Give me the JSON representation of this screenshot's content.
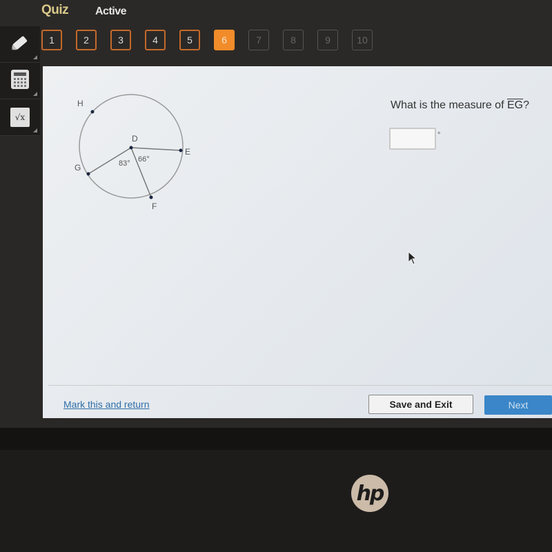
{
  "header": {
    "title": "Quiz",
    "status": "Active"
  },
  "question_nav": [
    {
      "label": "1",
      "state": "answered"
    },
    {
      "label": "2",
      "state": "answered"
    },
    {
      "label": "3",
      "state": "answered"
    },
    {
      "label": "4",
      "state": "answered"
    },
    {
      "label": "5",
      "state": "answered"
    },
    {
      "label": "6",
      "state": "current"
    },
    {
      "label": "7",
      "state": "locked"
    },
    {
      "label": "8",
      "state": "locked"
    },
    {
      "label": "9",
      "state": "locked"
    },
    {
      "label": "10",
      "state": "locked"
    }
  ],
  "tools": [
    {
      "name": "pencil-icon"
    },
    {
      "name": "calculator-icon"
    },
    {
      "name": "formula-icon",
      "glyph": "√x"
    }
  ],
  "diagram": {
    "points": {
      "H": "H",
      "D": "D",
      "E": "E",
      "G": "G",
      "F": "F"
    },
    "angle_gdf": "83°",
    "angle_fde": "66°"
  },
  "question": {
    "prefix": "What is the measure of ",
    "arc": "EG",
    "suffix": "?",
    "answer_value": "",
    "unit": "°"
  },
  "footer": {
    "mark_label": "Mark this and return",
    "save_label": "Save and Exit",
    "next_label": "Next"
  },
  "colors": {
    "accent": "#f28c2a",
    "link": "#2f6ea8",
    "next_button": "#3a86c8"
  },
  "brand": {
    "logo_text": "hp"
  }
}
